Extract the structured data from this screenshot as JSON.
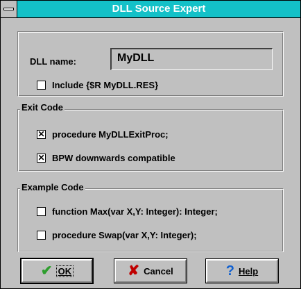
{
  "window": {
    "title": "DLL Source Expert"
  },
  "dll_group": {
    "name_label": "DLL name:",
    "name_value": "MyDLL",
    "include_label": "Include {$R MyDLL.RES}",
    "include_checked": false
  },
  "exit_group": {
    "legend": "Exit Code",
    "items": [
      {
        "label": "procedure MyDLLExitProc;",
        "checked": true
      },
      {
        "label": "BPW downwards compatible",
        "checked": true
      }
    ]
  },
  "example_group": {
    "legend": "Example Code",
    "items": [
      {
        "label": "function Max(var X,Y: Integer): Integer;",
        "checked": false
      },
      {
        "label": "procedure Swap(var X,Y: Integer);",
        "checked": false
      }
    ]
  },
  "buttons": {
    "ok": {
      "label": "OK",
      "icon": "check-icon",
      "color": "#2e9e2e"
    },
    "cancel": {
      "label": "Cancel",
      "icon": "x-icon",
      "color": "#c00000"
    },
    "help": {
      "label": "Help",
      "icon": "question-icon",
      "color": "#1060d0"
    }
  },
  "colors": {
    "titlebar": "#13c1c8",
    "face": "#c0c0c0"
  }
}
